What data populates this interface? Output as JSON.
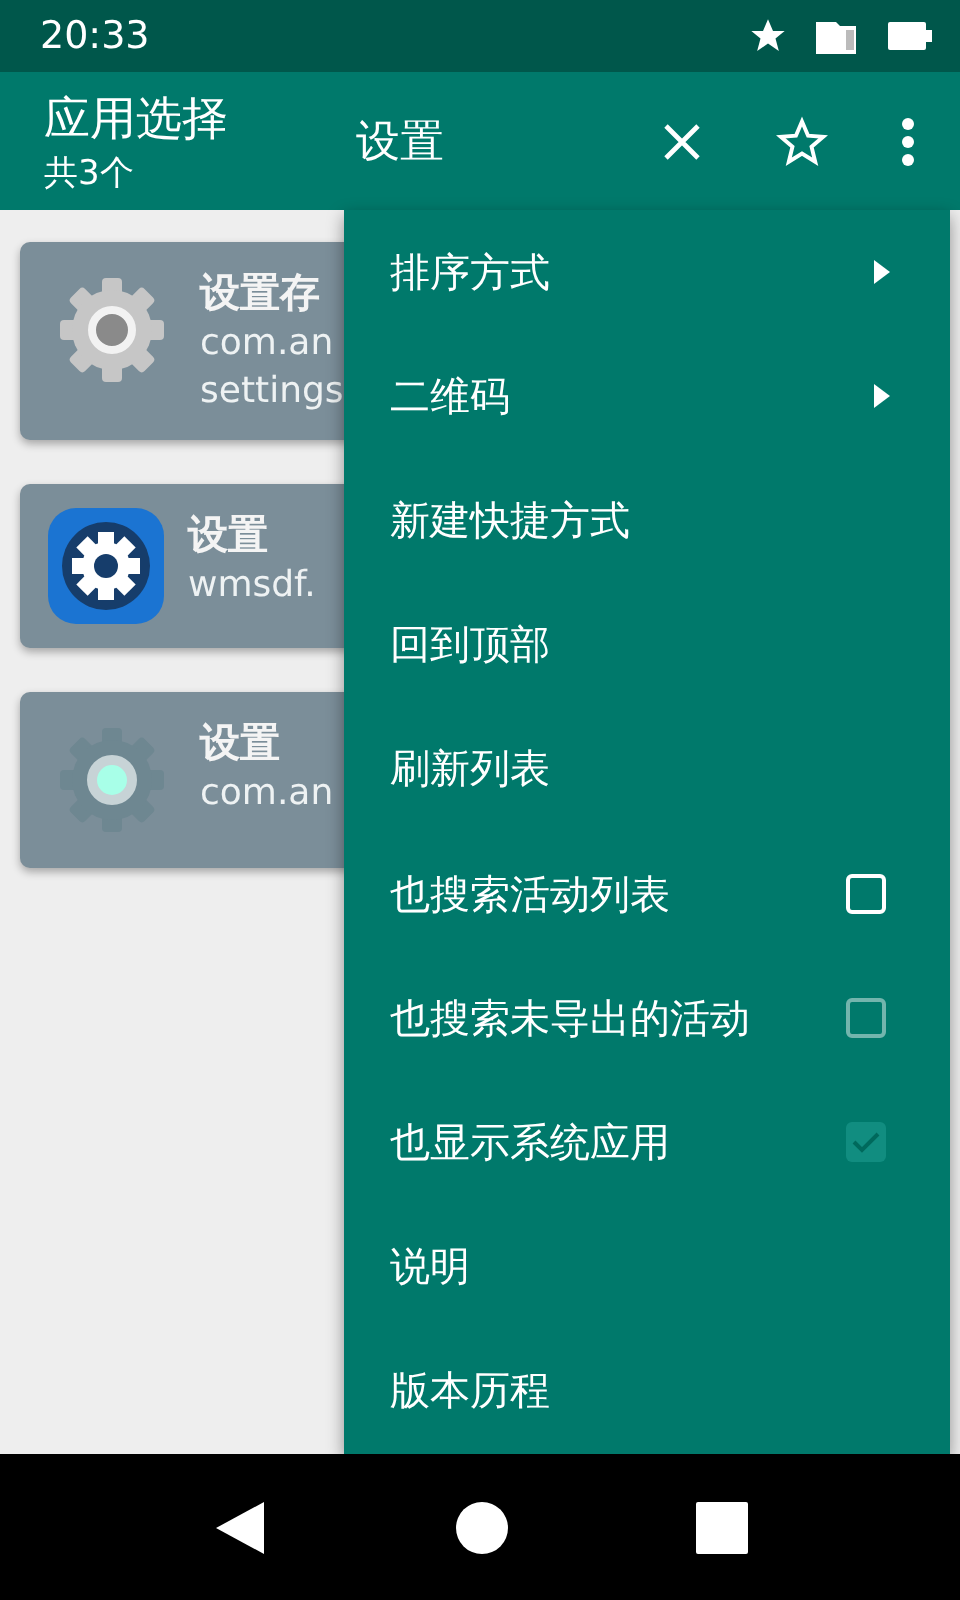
{
  "status_bar": {
    "time": "20:33"
  },
  "toolbar": {
    "title": "应用选择",
    "subtitle": "共3个",
    "search": {
      "value": "设置"
    }
  },
  "apps": [
    {
      "name": "设置存",
      "package": [
        "com.an",
        "settings"
      ],
      "kind": "gray"
    },
    {
      "name": "设置",
      "package": [
        "wmsdf."
      ],
      "kind": "blue"
    },
    {
      "name": "设置",
      "package": [
        "com.an"
      ],
      "kind": "teal"
    }
  ],
  "menu": [
    {
      "kind": "submenu",
      "label": "排序方式"
    },
    {
      "kind": "submenu",
      "label": "二维码"
    },
    {
      "kind": "plain",
      "label": "新建快捷方式"
    },
    {
      "kind": "plain",
      "label": "回到顶部"
    },
    {
      "kind": "plain",
      "label": "刷新列表"
    },
    {
      "kind": "checkbox",
      "label": "也搜索活动列表",
      "checked": false,
      "disabled": false
    },
    {
      "kind": "checkbox",
      "label": "也搜索未导出的活动",
      "checked": false,
      "disabled": true
    },
    {
      "kind": "checkbox",
      "label": "也显示系统应用",
      "checked": true,
      "disabled": true
    },
    {
      "kind": "plain",
      "label": "说明"
    },
    {
      "kind": "plain",
      "label": "版本历程"
    }
  ]
}
